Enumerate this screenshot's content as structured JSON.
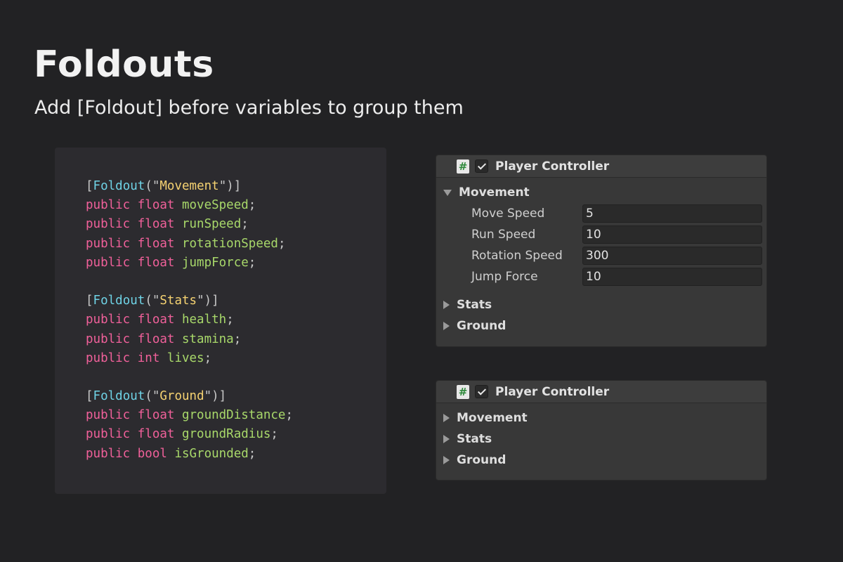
{
  "title": "Foldouts",
  "subtitle": "Add [Foldout] before variables to group them",
  "code": {
    "lines": [
      [
        {
          "t": "[",
          "c": "p"
        },
        {
          "t": "Foldout",
          "c": "a"
        },
        {
          "t": "(\"",
          "c": "p"
        },
        {
          "t": "Movement",
          "c": "s"
        },
        {
          "t": "\")]",
          "c": "p"
        }
      ],
      [
        {
          "t": "public float ",
          "c": "k"
        },
        {
          "t": "moveSpeed",
          "c": "v"
        },
        {
          "t": ";",
          "c": "p"
        }
      ],
      [
        {
          "t": "public float ",
          "c": "k"
        },
        {
          "t": "runSpeed",
          "c": "v"
        },
        {
          "t": ";",
          "c": "p"
        }
      ],
      [
        {
          "t": "public float ",
          "c": "k"
        },
        {
          "t": "rotationSpeed",
          "c": "v"
        },
        {
          "t": ";",
          "c": "p"
        }
      ],
      [
        {
          "t": "public float ",
          "c": "k"
        },
        {
          "t": "jumpForce",
          "c": "v"
        },
        {
          "t": ";",
          "c": "p"
        }
      ],
      [],
      [
        {
          "t": "[",
          "c": "p"
        },
        {
          "t": "Foldout",
          "c": "a"
        },
        {
          "t": "(\"",
          "c": "p"
        },
        {
          "t": "Stats",
          "c": "s"
        },
        {
          "t": "\")]",
          "c": "p"
        }
      ],
      [
        {
          "t": "public float ",
          "c": "k"
        },
        {
          "t": "health",
          "c": "v"
        },
        {
          "t": ";",
          "c": "p"
        }
      ],
      [
        {
          "t": "public float ",
          "c": "k"
        },
        {
          "t": "stamina",
          "c": "v"
        },
        {
          "t": ";",
          "c": "p"
        }
      ],
      [
        {
          "t": "public int ",
          "c": "k"
        },
        {
          "t": "lives",
          "c": "v"
        },
        {
          "t": ";",
          "c": "p"
        }
      ],
      [],
      [
        {
          "t": "[",
          "c": "p"
        },
        {
          "t": "Foldout",
          "c": "a"
        },
        {
          "t": "(\"",
          "c": "p"
        },
        {
          "t": "Ground",
          "c": "s"
        },
        {
          "t": "\")]",
          "c": "p"
        }
      ],
      [
        {
          "t": "public float ",
          "c": "k"
        },
        {
          "t": "groundDistance",
          "c": "v"
        },
        {
          "t": ";",
          "c": "p"
        }
      ],
      [
        {
          "t": "public float ",
          "c": "k"
        },
        {
          "t": "groundRadius",
          "c": "v"
        },
        {
          "t": ";",
          "c": "p"
        }
      ],
      [
        {
          "t": "public bool ",
          "c": "k"
        },
        {
          "t": "isGrounded",
          "c": "v"
        },
        {
          "t": ";",
          "c": "p"
        }
      ]
    ]
  },
  "inspector_expanded": {
    "script_icon": "#",
    "enabled": true,
    "title": "Player Controller",
    "movement_label": "Movement",
    "fields": [
      {
        "label": "Move Speed",
        "value": "5"
      },
      {
        "label": "Run Speed",
        "value": "10"
      },
      {
        "label": "Rotation Speed",
        "value": "300"
      },
      {
        "label": "Jump Force",
        "value": "10"
      }
    ],
    "stats_label": "Stats",
    "ground_label": "Ground"
  },
  "inspector_collapsed": {
    "script_icon": "#",
    "enabled": true,
    "title": "Player Controller",
    "movement_label": "Movement",
    "stats_label": "Stats",
    "ground_label": "Ground"
  }
}
